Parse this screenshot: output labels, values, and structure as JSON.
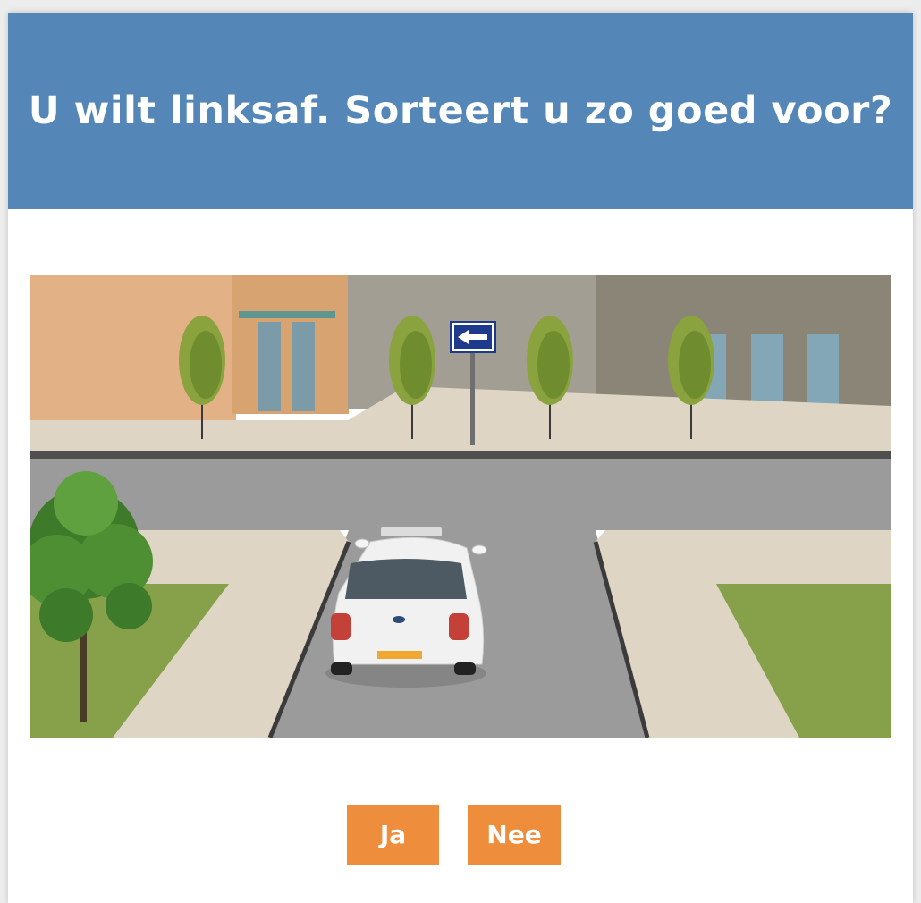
{
  "question": {
    "title": "U wilt linksaf. Sorteert u zo goed voor?"
  },
  "scene": {
    "icons": [
      "one-way-sign-left-arrow-icon",
      "car-icon",
      "tree-icon"
    ],
    "colors": {
      "header": "#5486b7",
      "button": "#ee8d3b",
      "sign": "#1d3a8c",
      "road": "#9b9b9b",
      "grass": "#86a14a"
    }
  },
  "answers": {
    "yes_label": "Ja",
    "no_label": "Nee"
  }
}
